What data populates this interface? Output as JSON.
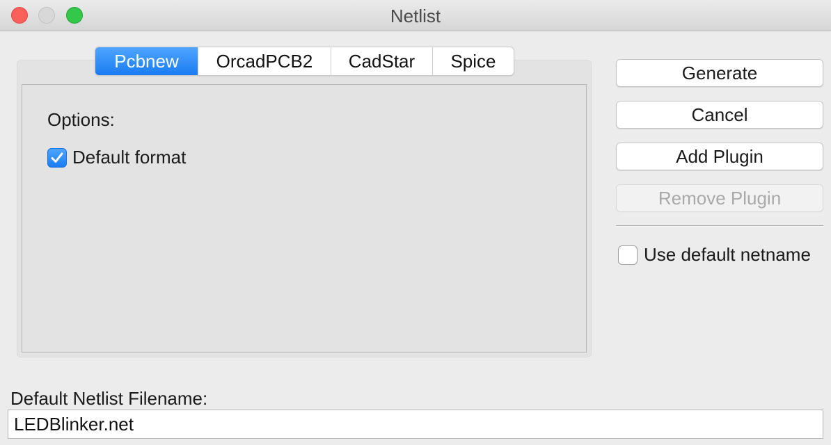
{
  "window": {
    "title": "Netlist"
  },
  "tabs": [
    {
      "label": "Pcbnew",
      "active": true
    },
    {
      "label": "OrcadPCB2",
      "active": false
    },
    {
      "label": "CadStar",
      "active": false
    },
    {
      "label": "Spice",
      "active": false
    }
  ],
  "pcbnew_panel": {
    "options_label": "Options:",
    "default_format": {
      "label": "Default format",
      "checked": true
    }
  },
  "buttons": {
    "generate": "Generate",
    "cancel": "Cancel",
    "add_plugin": "Add Plugin",
    "remove_plugin": "Remove Plugin"
  },
  "use_default_netname": {
    "label": "Use default netname",
    "checked": false
  },
  "filename": {
    "label": "Default Netlist Filename:",
    "value": "LEDBlinker.net"
  },
  "colors": {
    "accent": "#1a7cf2",
    "close": "#fc605b",
    "minimize": "#d8d8d8",
    "maximize": "#34c84a"
  }
}
